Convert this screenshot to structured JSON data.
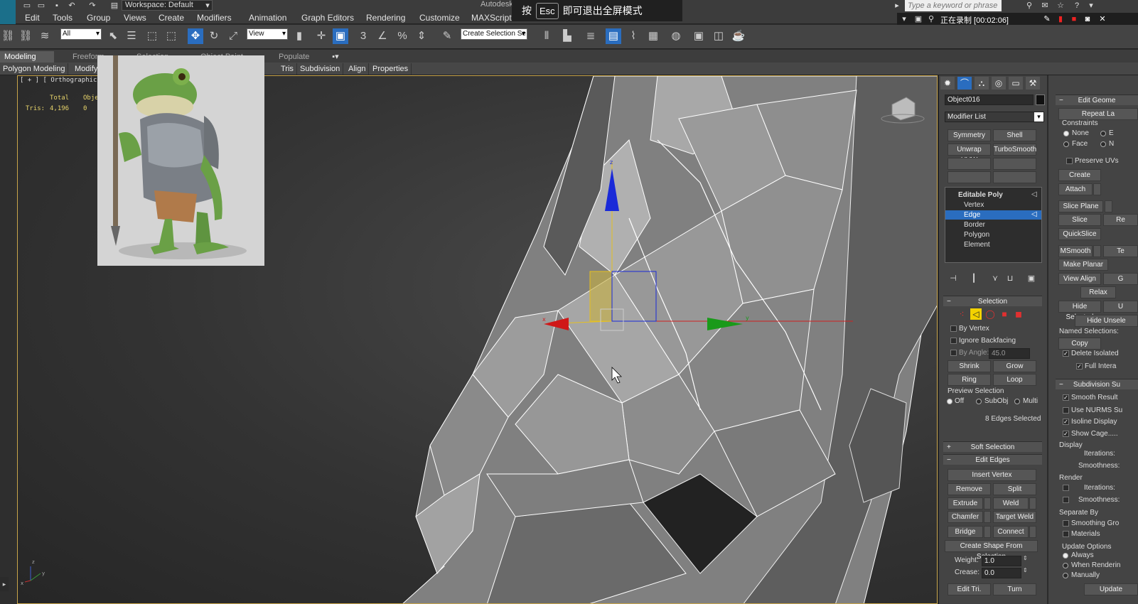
{
  "title_bar": {
    "workspace": "Workspace: Default",
    "app_title": "Autodesk",
    "quick_access": [
      "new-file-icon",
      "open-icon",
      "save-icon",
      "undo-icon",
      "redo-icon",
      "project-icon"
    ]
  },
  "menu": [
    "Edit",
    "Tools",
    "Group",
    "Views",
    "Create",
    "Modifiers",
    "Animation",
    "Graph Editors",
    "Rendering",
    "Customize",
    "MAXScript"
  ],
  "fullscreen_overlay": {
    "prefix": "按",
    "key": "Esc",
    "message": "即可退出全屏模式"
  },
  "search": {
    "placeholder": "Type a keyword or phrase"
  },
  "recording": {
    "status": "正在录制 [00:02:06]"
  },
  "toolbar": {
    "selection_filter": "All",
    "ref_coord": "View",
    "named_selection": "Create Selection Se"
  },
  "ribbon": {
    "tabs": [
      "Modeling",
      "Freeform",
      "Selection",
      "Object Paint",
      "Populate"
    ],
    "active_tab": "Modeling",
    "sub_items": [
      "Polygon Modeling",
      "Modify",
      "Tris",
      "Subdivision",
      "Align",
      "Properties"
    ]
  },
  "viewport": {
    "label": "[ + ] [ Orthographic ] [ S",
    "stats_header_total": "Total",
    "stats_header_obj": "Obje",
    "stats_tris_label": "Tris:",
    "stats_tris_total": "4,196",
    "stats_tris_obj": "0",
    "axis_labels": {
      "x": "x",
      "y": "y",
      "z": "z"
    }
  },
  "command_panel": {
    "object_name": "Object016",
    "object_color": "#111111",
    "modifier_list": "Modifier List",
    "modifier_buttons": [
      "Symmetry",
      "Shell",
      "Unwrap UVW",
      "TurboSmooth"
    ],
    "stack": {
      "root": "Editable Poly",
      "items": [
        "Vertex",
        "Edge",
        "Border",
        "Polygon",
        "Element"
      ],
      "selected": "Edge"
    },
    "selection": {
      "title": "Selection",
      "by_vertex": "By Vertex",
      "ignore_backfacing": "Ignore Backfacing",
      "by_angle": "By Angle:",
      "angle_value": "45.0",
      "shrink": "Shrink",
      "grow": "Grow",
      "ring": "Ring",
      "loop": "Loop",
      "preview_title": "Preview Selection",
      "preview_options": [
        "Off",
        "SubObj",
        "Multi"
      ],
      "status": "8 Edges Selected"
    },
    "soft_selection": "Soft Selection",
    "edit_edges": {
      "title": "Edit Edges",
      "insert_vertex": "Insert Vertex",
      "remove": "Remove",
      "split": "Split",
      "extrude": "Extrude",
      "weld": "Weld",
      "chamfer": "Chamfer",
      "target_weld": "Target Weld",
      "bridge": "Bridge",
      "connect": "Connect",
      "create_shape": "Create Shape From Selection",
      "weight_label": "Weight:",
      "weight_value": "1.0",
      "crease_label": "Crease:",
      "crease_value": "0.0",
      "edit_tri": "Edit Tri.",
      "turn": "Turn"
    }
  },
  "command_panel_2": {
    "edit_geometry": "Edit Geome",
    "repeat_last": "Repeat La",
    "constraints": "Constraints",
    "constraint_none": "None",
    "constraint_e": "E",
    "constraint_face": "Face",
    "constraint_n": "N",
    "preserve_uvs": "Preserve UVs",
    "create": "Create",
    "attach": "Attach",
    "slice_plane": "Slice Plane",
    "slice": "Slice",
    "reset": "Re",
    "quickslice": "QuickSlice",
    "msmooth": "MSmooth",
    "tessellate": "Te",
    "make_planar": "Make Planar",
    "view_align": "View Align",
    "view_align_g": "G",
    "relax": "Relax",
    "hide_selected": "Hide Selected",
    "unhide": "U",
    "hide_unselected": "Hide Unsele",
    "named_selections": "Named Selections:",
    "copy": "Copy",
    "delete_isolated": "Delete Isolated",
    "full_interactivity": "Full Intera",
    "subdivision": "Subdivision Su",
    "smooth_result": "Smooth Result",
    "use_nurms": "Use NURMS Su",
    "isoline_display": "Isoline Display",
    "show_cage": "Show Cage.....",
    "display": "Display",
    "iterations": "Iterations:",
    "smoothness": "Smoothness:",
    "render": "Render",
    "separate_by": "Separate By",
    "smoothing_groups": "Smoothing Gro",
    "materials": "Materials",
    "update_options": "Update Options",
    "always": "Always",
    "when_rendering": "When Renderin",
    "manually": "Manually",
    "update": "Update"
  }
}
